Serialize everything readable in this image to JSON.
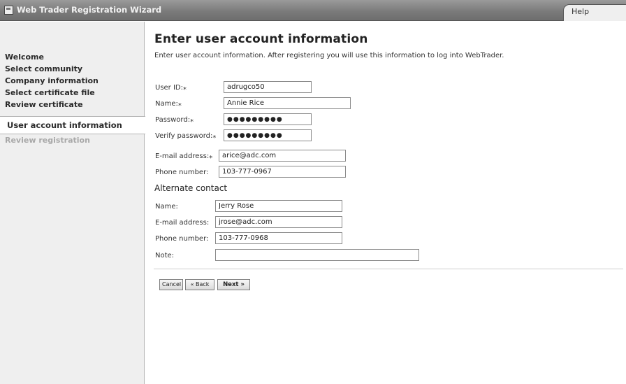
{
  "window": {
    "title": "Web Trader Registration Wizard",
    "help_label": "Help"
  },
  "sidebar": {
    "items": [
      "Welcome",
      "Select community",
      "Company information",
      "Select certificate file",
      "Review certificate"
    ],
    "active": "User account information",
    "disabled": "Review registration"
  },
  "main": {
    "title": "Enter user account information",
    "description": "Enter user account information. After registering you will use this information to log into WebTrader."
  },
  "form": {
    "user_id": {
      "label": "User ID:⁎",
      "value": "adrugco50"
    },
    "name": {
      "label": "Name:⁎",
      "value": "Annie Rice"
    },
    "password": {
      "label": "Password:⁎",
      "value": "●●●●●●●●●"
    },
    "verify_password": {
      "label": "Verify password:⁎",
      "value": "●●●●●●●●●"
    },
    "email": {
      "label": "E-mail address:⁎",
      "value": "arice@adc.com"
    },
    "phone": {
      "label": "Phone number:",
      "value": "103-777-0967"
    }
  },
  "alternate": {
    "heading": "Alternate contact",
    "name": {
      "label": "Name:",
      "value": "Jerry Rose"
    },
    "email": {
      "label": "E-mail address:",
      "value": "jrose@adc.com"
    },
    "phone": {
      "label": "Phone number:",
      "value": "103-777-0968"
    },
    "note": {
      "label": "Note:",
      "value": ""
    }
  },
  "buttons": {
    "cancel": "Cancel",
    "back": "« Back",
    "next": "Next »"
  }
}
